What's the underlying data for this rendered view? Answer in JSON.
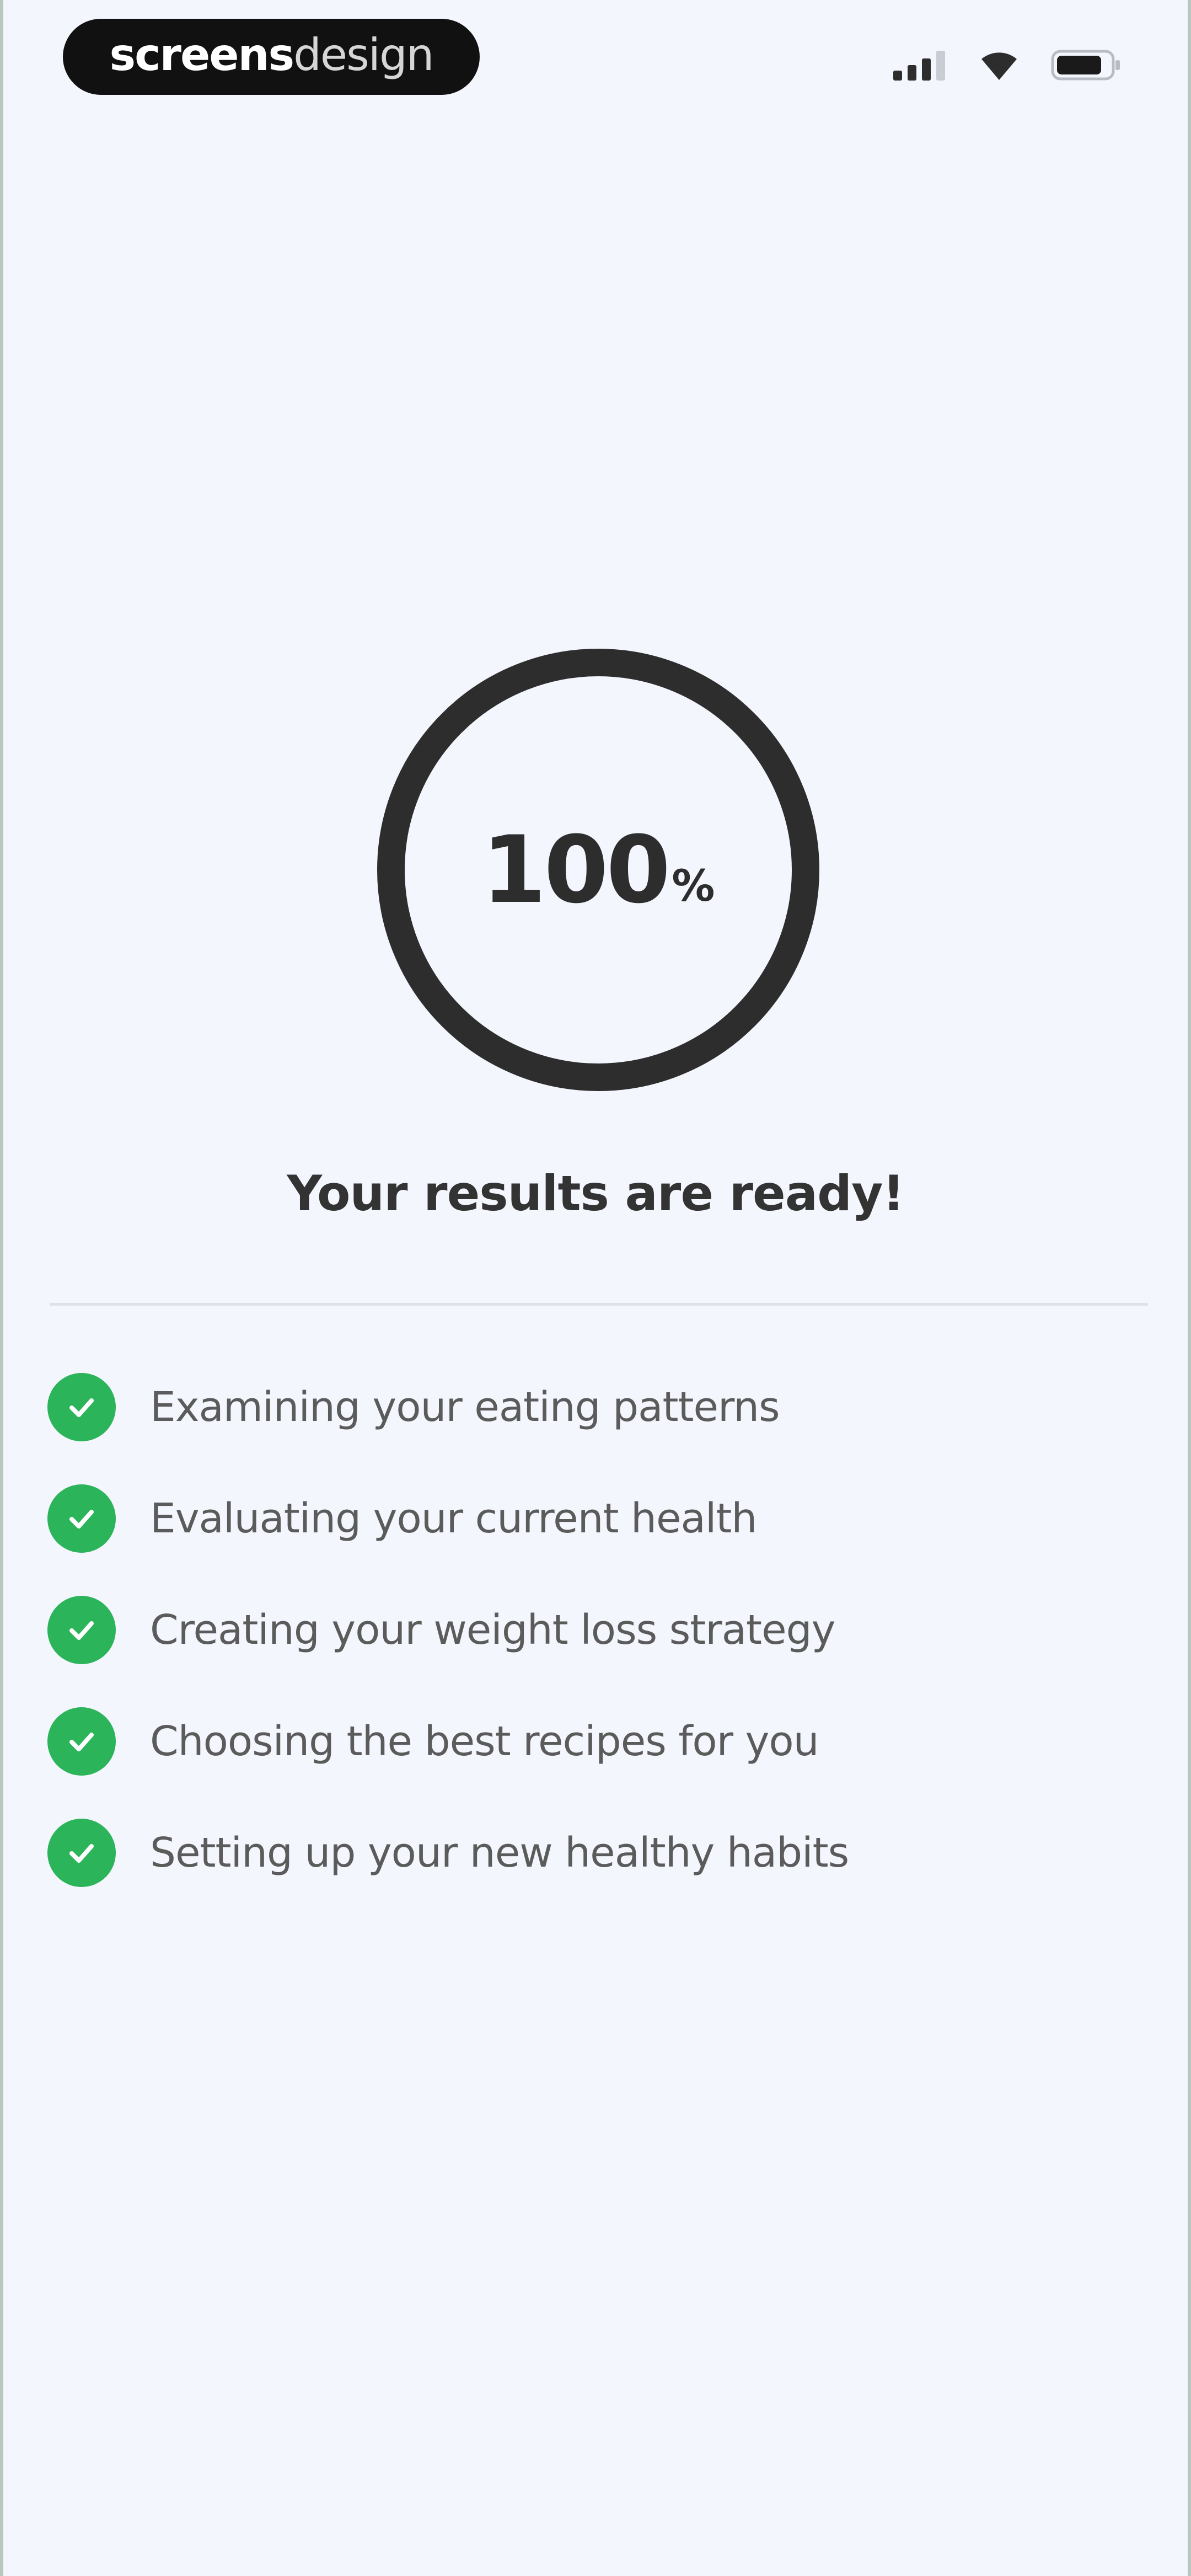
{
  "brand": {
    "part_strong": "screens",
    "part_light": "design"
  },
  "status_bar": {
    "icons": [
      "cellular-signal-icon",
      "wifi-icon",
      "battery-icon"
    ]
  },
  "progress": {
    "value": "100",
    "unit": "%",
    "fraction": 1.0
  },
  "results": {
    "title": "Your results are ready!"
  },
  "steps": [
    {
      "label": "Examining your eating patterns",
      "done": true
    },
    {
      "label": "Evaluating your current health",
      "done": true
    },
    {
      "label": "Creating your weight loss strategy",
      "done": true
    },
    {
      "label": "Choosing the best recipes for you",
      "done": true
    },
    {
      "label": "Setting up your new healthy habits",
      "done": true
    }
  ],
  "colors": {
    "background": "#f3f6fd",
    "ring": "#2d2d2d",
    "check": "#2bb45a",
    "text": "#5b5b5b",
    "title": "#333333"
  }
}
